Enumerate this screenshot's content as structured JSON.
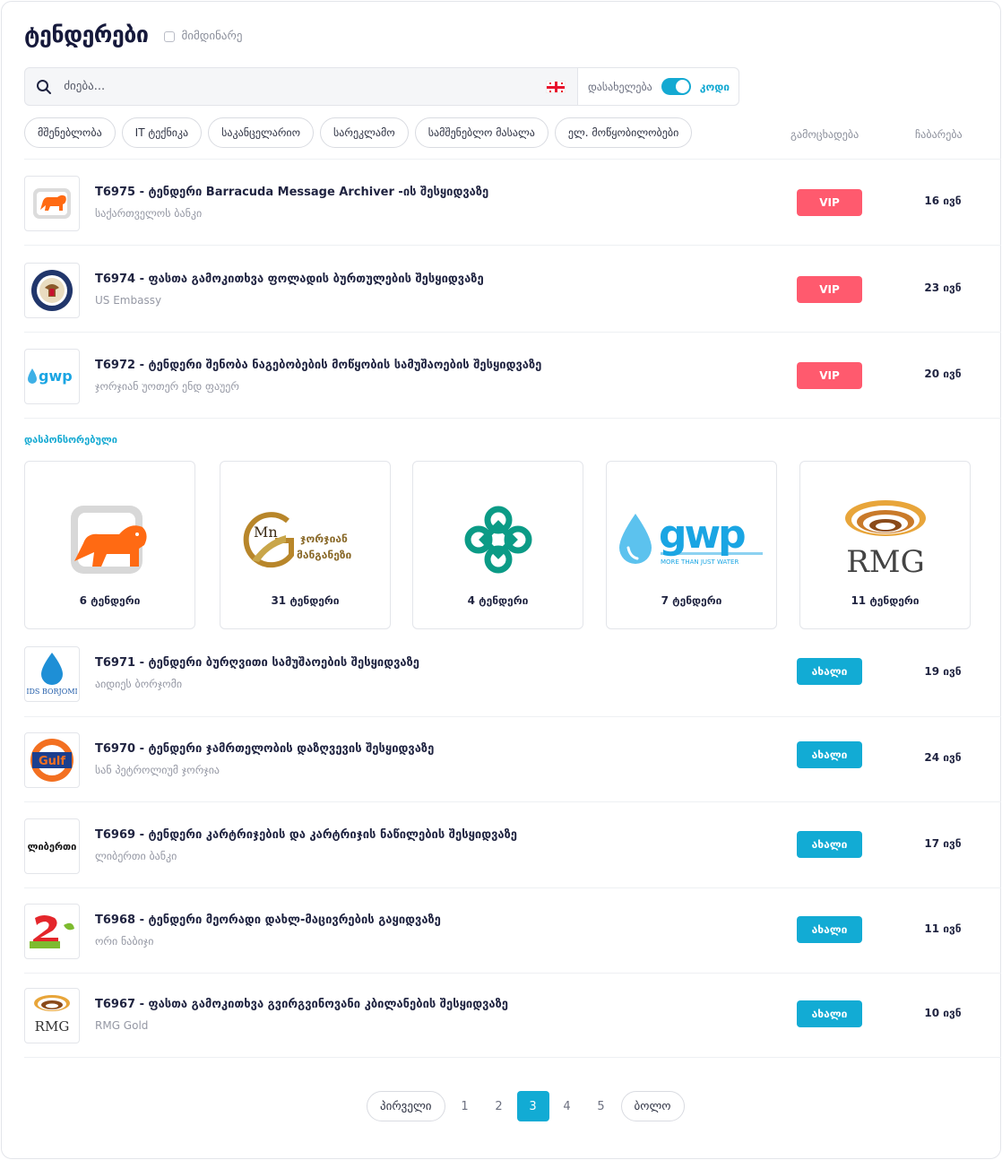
{
  "header": {
    "title": "ტენდერები",
    "current_label": "მიმდინარე"
  },
  "search": {
    "placeholder": "ძიება...",
    "toggle_left": "დასახელება",
    "toggle_right": "კოდი"
  },
  "categories": [
    "მშენებლობა",
    "IT ტექნიკა",
    "საკანცელარიო",
    "სარეკლამო",
    "სამშენებლო მასალა",
    "ელ. მოწყობილობები"
  ],
  "columns": {
    "announce": "გამოცხადება",
    "deadline": "ჩაბარება"
  },
  "tenders_top": [
    {
      "title": "T6975 - ტენდერი Barracuda Message Archiver -ის შესყიდვაზე",
      "org": "საქართველოს ბანკი",
      "badge": "VIP",
      "deadline": "16 ივნ",
      "logo": "bog-lion-icon"
    },
    {
      "title": "T6974 - ფასთა გამოკითხვა ფოლადის ბურთულების შესყიდვაზე",
      "org": "US Embassy",
      "badge": "VIP",
      "deadline": "23 ივნ",
      "logo": "us-embassy-seal-icon"
    },
    {
      "title": "T6972 - ტენდერი შენობა ნაგებობების მოწყობის სამუშაოების შესყიდვაზე",
      "org": "ჯორჯიან უოთერ ენდ ფაუერ",
      "badge": "VIP",
      "deadline": "20 ივნ",
      "logo": "gwp-logo-icon"
    }
  ],
  "sponsored": {
    "label": "დასპონსორებული",
    "cards": [
      {
        "count": "6 ტენდერი",
        "logo": "bog-lion-icon"
      },
      {
        "count": "31 ტენდერი",
        "logo": "georgian-manganese-icon",
        "logo_text_1": "Mn",
        "logo_text_2": "ჯორჯიან",
        "logo_text_3": "მანგანეზი"
      },
      {
        "count": "4 ტენდერი",
        "logo": "knot-logo-icon"
      },
      {
        "count": "7 ტენდერი",
        "logo": "gwp-logo-icon",
        "logo_text_1": "gwp",
        "logo_text_2": "MORE THAN JUST WATER"
      },
      {
        "count": "11 ტენდერი",
        "logo": "rmg-logo-icon",
        "logo_text_1": "RMG"
      }
    ]
  },
  "tenders_bottom": [
    {
      "title": "T6971 - ტენდერი ბურღვითი სამუშაოების შესყიდვაზე",
      "org": "აიდიეს ბორჯომი",
      "badge": "ახალი",
      "deadline": "19 ივნ",
      "logo": "ids-borjomi-icon",
      "logo_text": "IDS BORJOMI"
    },
    {
      "title": "T6970 - ტენდერი ჯამრთელობის დაზღვევის შესყიდვაზე",
      "org": "სან პეტროლიუმ ჯორჯია",
      "badge": "ახალი",
      "deadline": "24 ივნ",
      "logo": "gulf-logo-icon",
      "logo_text": "Gulf"
    },
    {
      "title": "T6969 - ტენდერი კარტრიჯების და კარტრიჯის ნაწილების შესყიდვაზე",
      "org": "ლიბერთი ბანკი",
      "badge": "ახალი",
      "deadline": "17 ივნ",
      "logo": "liberty-logo-icon",
      "logo_text": "ლიბერთი"
    },
    {
      "title": "T6968 - ტენდერი მეორადი დახლ-მაცივრების გაყიდვაზე",
      "org": "ორი ნაბიჯი",
      "badge": "ახალი",
      "deadline": "11 ივნ",
      "logo": "ori-nabiji-icon"
    },
    {
      "title": "T6967 - ფასთა გამოკითხვა გვირგვინოვანი კბილანების შესყიდვაზე",
      "org": "RMG Gold",
      "badge": "ახალი",
      "deadline": "10 ივნ",
      "logo": "rmg-logo-icon",
      "logo_text": "RMG"
    }
  ],
  "pagination": {
    "first": "პირველი",
    "last": "ბოლო",
    "pages": [
      "1",
      "2",
      "3",
      "4",
      "5"
    ],
    "current": "3"
  },
  "colors": {
    "accent": "#12abd4",
    "vip": "#ff5a6e",
    "title": "#16193b"
  }
}
